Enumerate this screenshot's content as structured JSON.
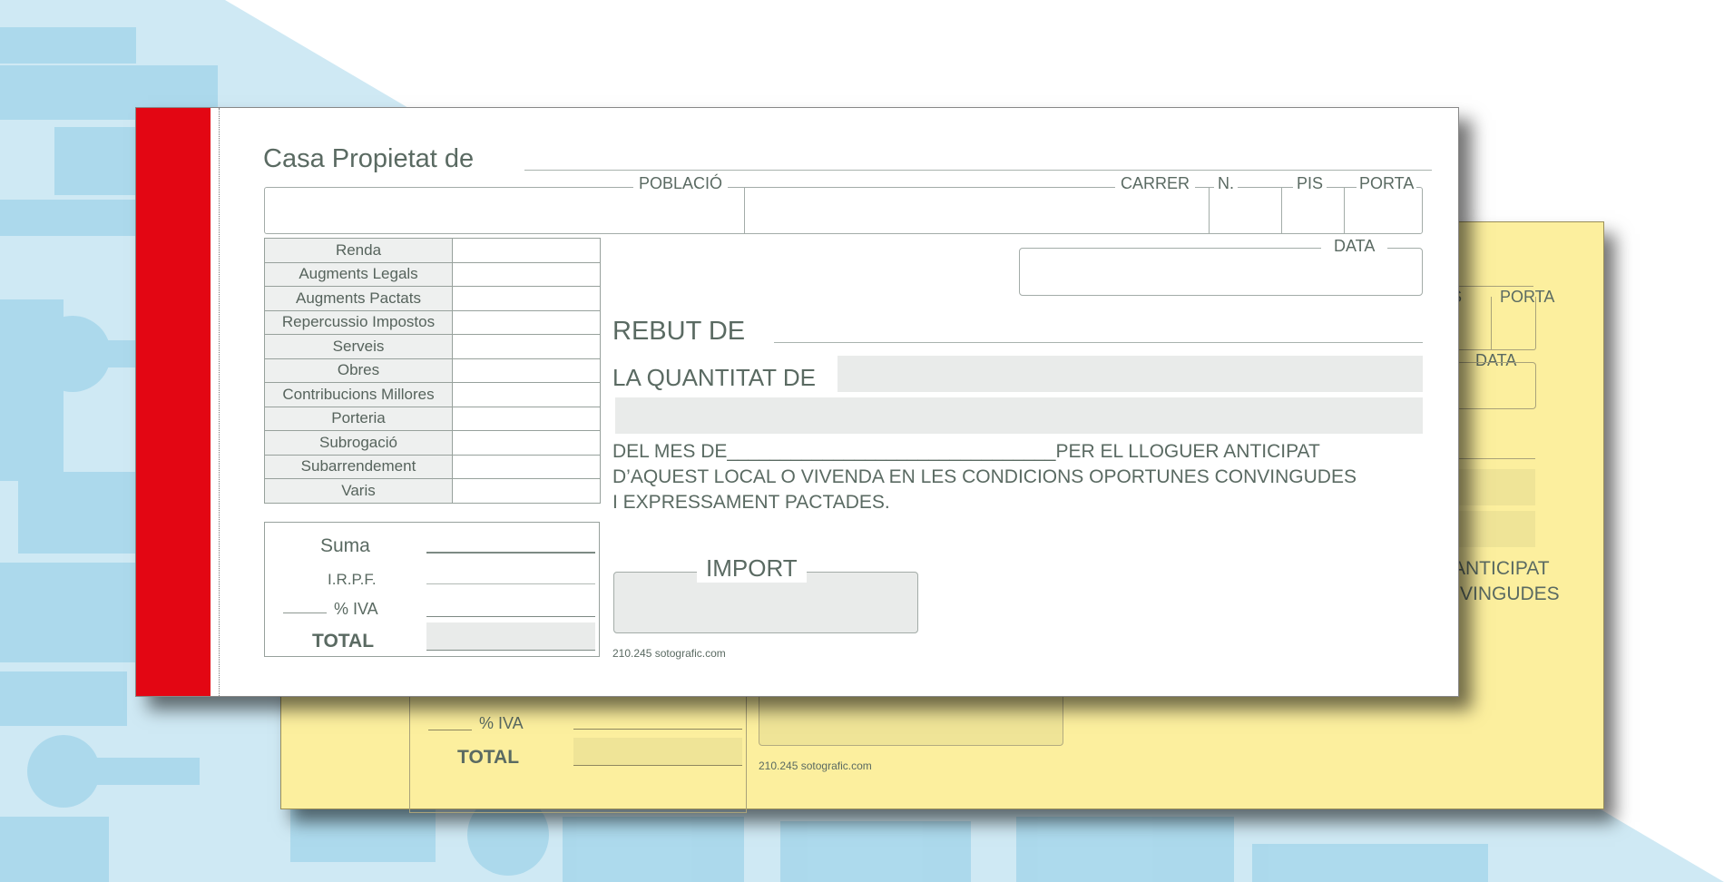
{
  "receipt": {
    "title": "Casa Propietat de",
    "fields": {
      "poblacio": "POBLACIÓ",
      "carrer": "CARRER",
      "numero": "N.",
      "pis": "PIS",
      "porta": "PORTA",
      "data": "DATA"
    },
    "concepts": [
      "Renda",
      "Augments Legals",
      "Augments Pactats",
      "Repercussio Impostos",
      "Serveis",
      "Obres",
      "Contribucions Millores",
      "Porteria",
      "Subrogació",
      "Subarrendement",
      "Varis"
    ],
    "totals": {
      "suma": "Suma",
      "irpf": "I.R.P.F.",
      "iva": "% IVA",
      "total": "TOTAL"
    },
    "rebut_de": "REBUT DE",
    "quantitat_de": "LA QUANTITAT DE",
    "body_lines": [
      "DEL MES DE_______________________________PER EL LLOGUER ANTICIPAT",
      "D’AQUEST LOCAL O VIVENDA  EN LES CONDICIONS OPORTUNES CONVINGUDES",
      "I EXPRESSAMENT  PACTADES."
    ],
    "import": "IMPORT",
    "footer_code": "210.245",
    "footer_site": "sotografic.com"
  },
  "copy_sheet": {
    "porta": "PORTA",
    "pis_fragment": "S",
    "data": "DATA",
    "body_fragments": [
      "ANTICIPAT",
      "VINGUDES"
    ],
    "iva": "% IVA",
    "total": "TOTAL",
    "footer_code": "210.245",
    "footer_site": "sotografic.com"
  },
  "colors": {
    "binding_stripe": "#e30613",
    "copy_paper": "#fcef9e",
    "background_pattern": "#a7d8ec",
    "text": "#5a6a62"
  }
}
